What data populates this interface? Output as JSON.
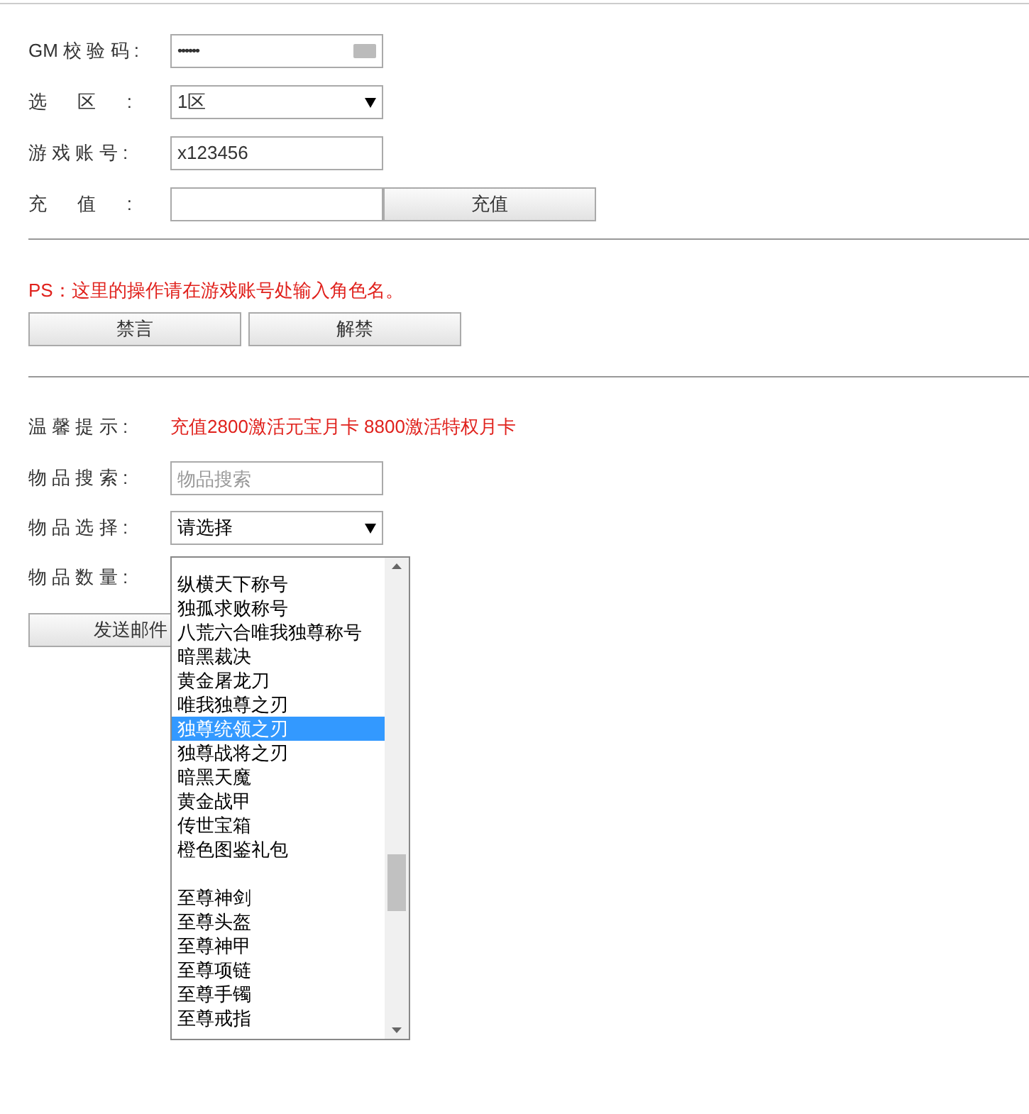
{
  "recharge_form": {
    "fields": [
      {
        "kind": "password",
        "label": "GM 校 验 码 :",
        "value": "••••••"
      },
      {
        "kind": "select",
        "label": "选      区      :",
        "value": "1区"
      },
      {
        "kind": "text",
        "label": "游 戏 账 号 :",
        "value": "x123456"
      },
      {
        "kind": "button_input",
        "label": "充      值      :",
        "button": "充值"
      }
    ]
  },
  "notice": "PS：这里的操作请在游戏账号处输入角色名。",
  "ban_buttons": [
    "禁言",
    "解禁"
  ],
  "mail_form": {
    "tip_label": "温 馨 提 示 :",
    "tip": "充值2800激活元宝月卡 8800激活特权月卡",
    "search": {
      "label": "物 品 搜 索 :",
      "placeholder": "物品搜索"
    },
    "select": {
      "label": "物 品 选 择 :",
      "value": "请选择"
    },
    "quantity": {
      "label": "物 品 数 量 :"
    },
    "send_button": "发送邮件"
  },
  "dropdown": {
    "option_groups": [
      {
        "options": [
          {
            "label": "纵横天下称号",
            "selected": false
          },
          {
            "label": "独孤求败称号",
            "selected": false
          },
          {
            "label": "八荒六合唯我独尊称号",
            "selected": false
          },
          {
            "label": "暗黑裁决",
            "selected": false
          },
          {
            "label": "黄金屠龙刀",
            "selected": false
          },
          {
            "label": "唯我独尊之刃",
            "selected": false
          },
          {
            "label": "独尊统领之刃",
            "selected": true
          },
          {
            "label": "独尊战将之刃",
            "selected": false
          },
          {
            "label": "暗黑天魔",
            "selected": false
          },
          {
            "label": "黄金战甲",
            "selected": false
          },
          {
            "label": "传世宝箱",
            "selected": false
          },
          {
            "label": "橙色图鉴礼包",
            "selected": false
          }
        ]
      },
      {
        "options": [
          {
            "label": "至尊神剑",
            "selected": false
          },
          {
            "label": "至尊头盔",
            "selected": false
          },
          {
            "label": "至尊神甲",
            "selected": false
          },
          {
            "label": "至尊项链",
            "selected": false
          },
          {
            "label": "至尊手镯",
            "selected": false
          },
          {
            "label": "至尊戒指",
            "selected": false
          }
        ]
      }
    ]
  }
}
